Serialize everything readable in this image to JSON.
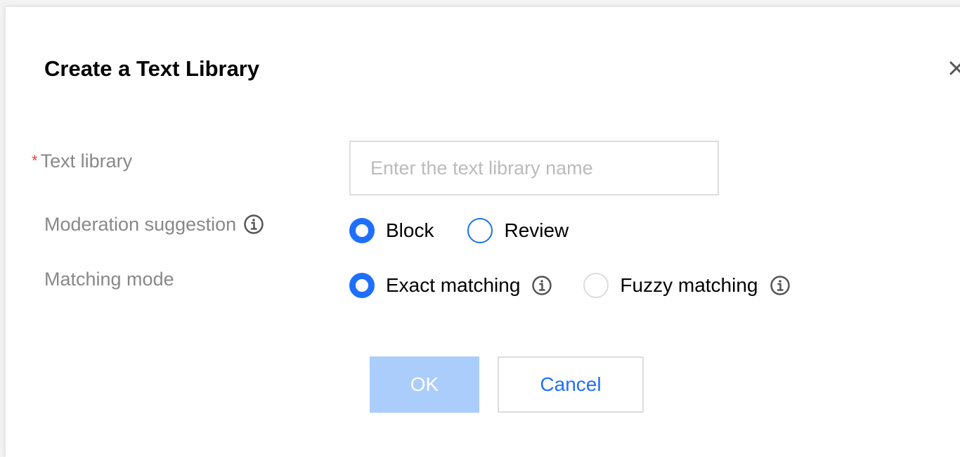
{
  "dialog": {
    "title": "Create a Text Library",
    "close_icon": "close-icon"
  },
  "form": {
    "name_field": {
      "required_mark": "*",
      "label": "Text library",
      "value": "",
      "placeholder": "Enter the text library name"
    },
    "moderation": {
      "label": "Moderation suggestion",
      "info_icon": "info-icon",
      "options": [
        {
          "label": "Block",
          "checked": true
        },
        {
          "label": "Review",
          "checked": false
        }
      ]
    },
    "matching": {
      "label": "Matching mode",
      "options": [
        {
          "label": "Exact matching",
          "checked": true,
          "info_icon": "info-icon"
        },
        {
          "label": "Fuzzy matching",
          "checked": false,
          "disabled": true,
          "info_icon": "info-icon"
        }
      ]
    }
  },
  "buttons": {
    "ok_label": "OK",
    "cancel_label": "Cancel"
  },
  "colors": {
    "primary": "#1f6fff",
    "ok_disabled_bg": "#aacdfb",
    "required": "#e54545",
    "label_gray": "#888888",
    "border": "#dddddd"
  }
}
